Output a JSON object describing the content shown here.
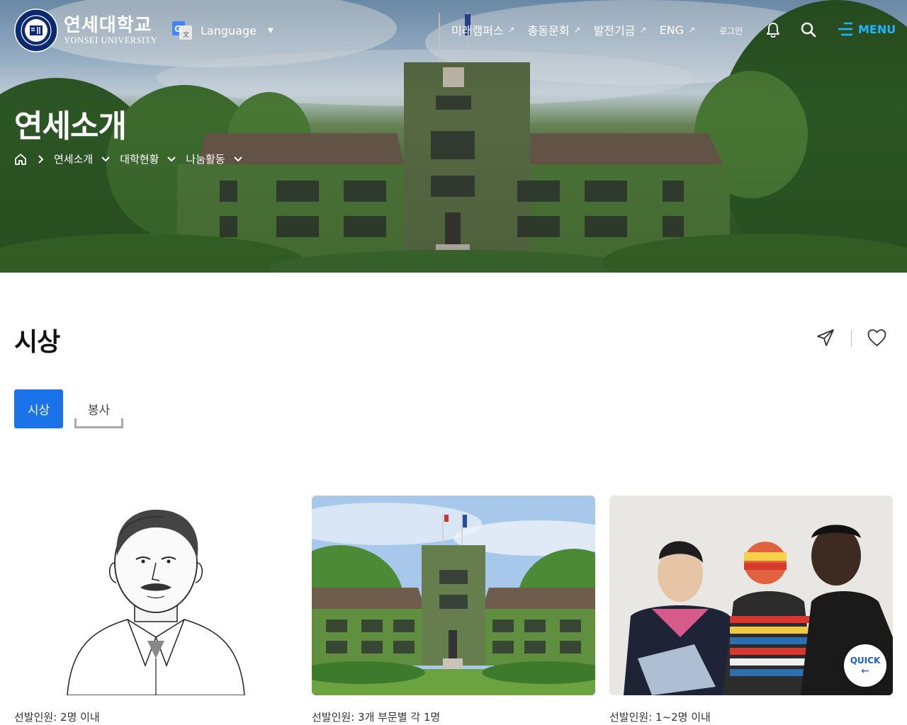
{
  "header": {
    "logo_ko": "연세대학교",
    "logo_en": "YONSEI UNIVERSITY",
    "language_label": "Language",
    "links": [
      {
        "label": "미래캠퍼스"
      },
      {
        "label": "총동문회"
      },
      {
        "label": "발전기금"
      },
      {
        "label": "ENG"
      }
    ],
    "login_label": "로그인",
    "menu_label": "MENU",
    "icons": {
      "bell": "bell-icon",
      "search": "search-icon",
      "menu": "hamburger-icon",
      "translate": "google-translate-icon"
    }
  },
  "hero": {
    "title": "연세소개",
    "breadcrumb": [
      "연세소개",
      "대학현황",
      "나눔활동"
    ]
  },
  "main": {
    "title": "시상",
    "tabs": [
      {
        "label": "시상",
        "active": true
      },
      {
        "label": "봉사",
        "active": false
      }
    ],
    "cards": [
      {
        "caption": "선발인원: 2명 이내"
      },
      {
        "caption": "선발인원: 3개 부문별 각 1명"
      },
      {
        "caption": "선발인원: 1~2명 이내"
      }
    ],
    "quick_label": "QUICK",
    "quick_arrow": "←"
  },
  "colors": {
    "accent": "#1a73e8",
    "menu": "#1fb6ff",
    "quick": "#1a5bd8"
  }
}
